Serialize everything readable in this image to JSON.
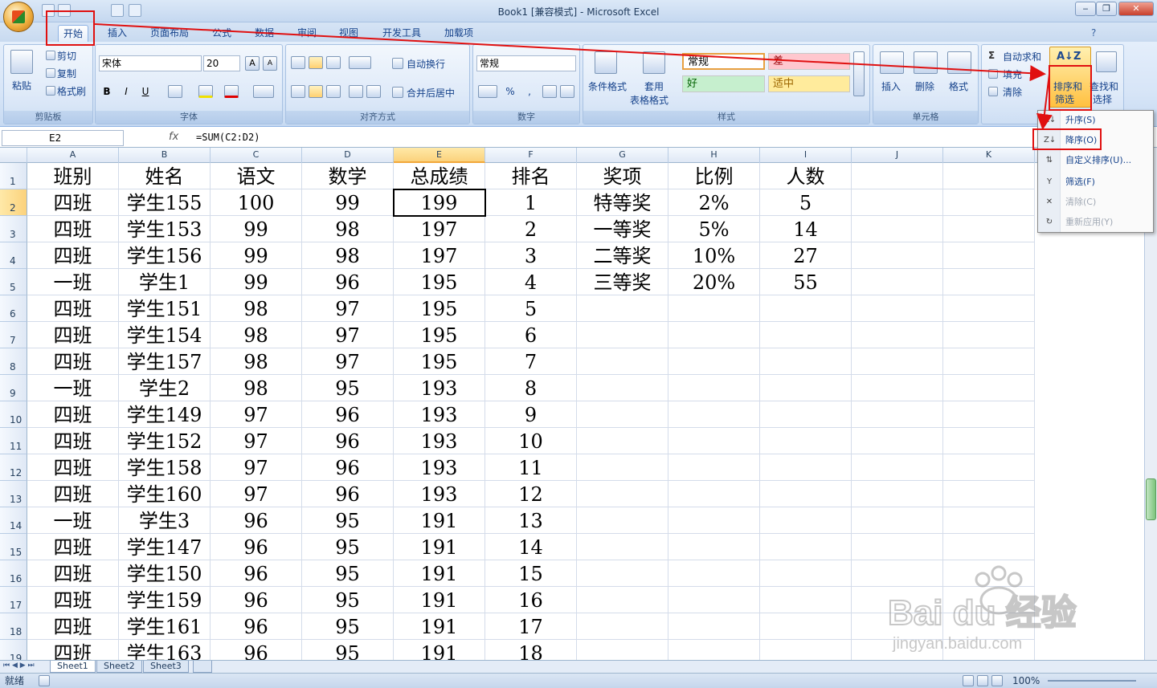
{
  "window": {
    "title": "Book1  [兼容模式] - Microsoft Excel"
  },
  "tabs": [
    "开始",
    "插入",
    "页面布局",
    "公式",
    "数据",
    "审阅",
    "视图",
    "开发工具",
    "加载项"
  ],
  "ribbon": {
    "clipboard": {
      "paste": "粘贴",
      "cut": "剪切",
      "copy": "复制",
      "format_painter": "格式刷",
      "label": "剪贴板"
    },
    "font": {
      "name": "宋体",
      "size": "20",
      "bold": "B",
      "italic": "I",
      "underline": "U",
      "label": "字体"
    },
    "alignment": {
      "wrap": "自动换行",
      "merge": "合并后居中",
      "label": "对齐方式"
    },
    "number": {
      "format": "常规",
      "percent": "%",
      "comma": ",",
      "label": "数字"
    },
    "styles": {
      "conditional": "条件格式",
      "table_line1": "套用",
      "table_line2": "表格格式",
      "normal": "常规",
      "bad": "差",
      "good": "好",
      "neutral": "适中",
      "label": "样式"
    },
    "cells": {
      "insert": "插入",
      "delete": "删除",
      "format": "格式",
      "label": "单元格"
    },
    "editing": {
      "autosum": "自动求和",
      "fill": "填充",
      "clear": "清除",
      "sort_line1": "排序和",
      "sort_line2": "筛选",
      "find_line1": "查找和",
      "find_line2": "选择"
    }
  },
  "formula_bar": {
    "name_box": "E2",
    "fx": "fx",
    "formula": "=SUM(C2:D2)"
  },
  "columns": [
    "A",
    "B",
    "C",
    "D",
    "E",
    "F",
    "G",
    "H",
    "I",
    "J",
    "K"
  ],
  "rows": [
    "1",
    "2",
    "3",
    "4",
    "5",
    "6",
    "7",
    "8",
    "9",
    "10",
    "11",
    "12",
    "13",
    "14",
    "15",
    "16",
    "17",
    "18",
    "19"
  ],
  "sheet": {
    "header": [
      "班别",
      "姓名",
      "语文",
      "数学",
      "总成绩",
      "排名",
      "奖项",
      "比例",
      "人数"
    ],
    "data": [
      [
        "四班",
        "学生155",
        "100",
        "99",
        "199",
        "1",
        "特等奖",
        "2%",
        "5"
      ],
      [
        "四班",
        "学生153",
        "99",
        "98",
        "197",
        "2",
        "一等奖",
        "5%",
        "14"
      ],
      [
        "四班",
        "学生156",
        "99",
        "98",
        "197",
        "3",
        "二等奖",
        "10%",
        "27"
      ],
      [
        "一班",
        "学生1",
        "99",
        "96",
        "195",
        "4",
        "三等奖",
        "20%",
        "55"
      ],
      [
        "四班",
        "学生151",
        "98",
        "97",
        "195",
        "5",
        "",
        "",
        ""
      ],
      [
        "四班",
        "学生154",
        "98",
        "97",
        "195",
        "6",
        "",
        "",
        ""
      ],
      [
        "四班",
        "学生157",
        "98",
        "97",
        "195",
        "7",
        "",
        "",
        ""
      ],
      [
        "一班",
        "学生2",
        "98",
        "95",
        "193",
        "8",
        "",
        "",
        ""
      ],
      [
        "四班",
        "学生149",
        "97",
        "96",
        "193",
        "9",
        "",
        "",
        ""
      ],
      [
        "四班",
        "学生152",
        "97",
        "96",
        "193",
        "10",
        "",
        "",
        ""
      ],
      [
        "四班",
        "学生158",
        "97",
        "96",
        "193",
        "11",
        "",
        "",
        ""
      ],
      [
        "四班",
        "学生160",
        "97",
        "96",
        "193",
        "12",
        "",
        "",
        ""
      ],
      [
        "一班",
        "学生3",
        "96",
        "95",
        "191",
        "13",
        "",
        "",
        ""
      ],
      [
        "四班",
        "学生147",
        "96",
        "95",
        "191",
        "14",
        "",
        "",
        ""
      ],
      [
        "四班",
        "学生150",
        "96",
        "95",
        "191",
        "15",
        "",
        "",
        ""
      ],
      [
        "四班",
        "学生159",
        "96",
        "95",
        "191",
        "16",
        "",
        "",
        ""
      ],
      [
        "四班",
        "学生161",
        "96",
        "95",
        "191",
        "17",
        "",
        "",
        ""
      ],
      [
        "四班",
        "学生163",
        "96",
        "95",
        "191",
        "18",
        "",
        "",
        ""
      ]
    ]
  },
  "sort_menu": [
    {
      "label": "升序(S)",
      "icon": "sort-ascending-icon",
      "disabled": false
    },
    {
      "label": "降序(O)",
      "icon": "sort-descending-icon",
      "disabled": false
    },
    {
      "label": "自定义排序(U)...",
      "icon": "custom-sort-icon",
      "disabled": false
    },
    {
      "label": "筛选(F)",
      "icon": "filter-icon",
      "disabled": false
    },
    {
      "label": "清除(C)",
      "icon": "clear-filter-icon",
      "disabled": true
    },
    {
      "label": "重新应用(Y)",
      "icon": "reapply-icon",
      "disabled": true
    }
  ],
  "sheet_tabs": [
    "Sheet1",
    "Sheet2",
    "Sheet3"
  ],
  "status": {
    "ready": "就绪",
    "zoom": "100%"
  },
  "watermark": {
    "brand": "Bai du 经验",
    "url": "jingyan.baidu.com"
  },
  "colors": {
    "annotation_red": "#e01010",
    "ribbon_blue": "#15428b",
    "active_header": "#fbd27c"
  }
}
